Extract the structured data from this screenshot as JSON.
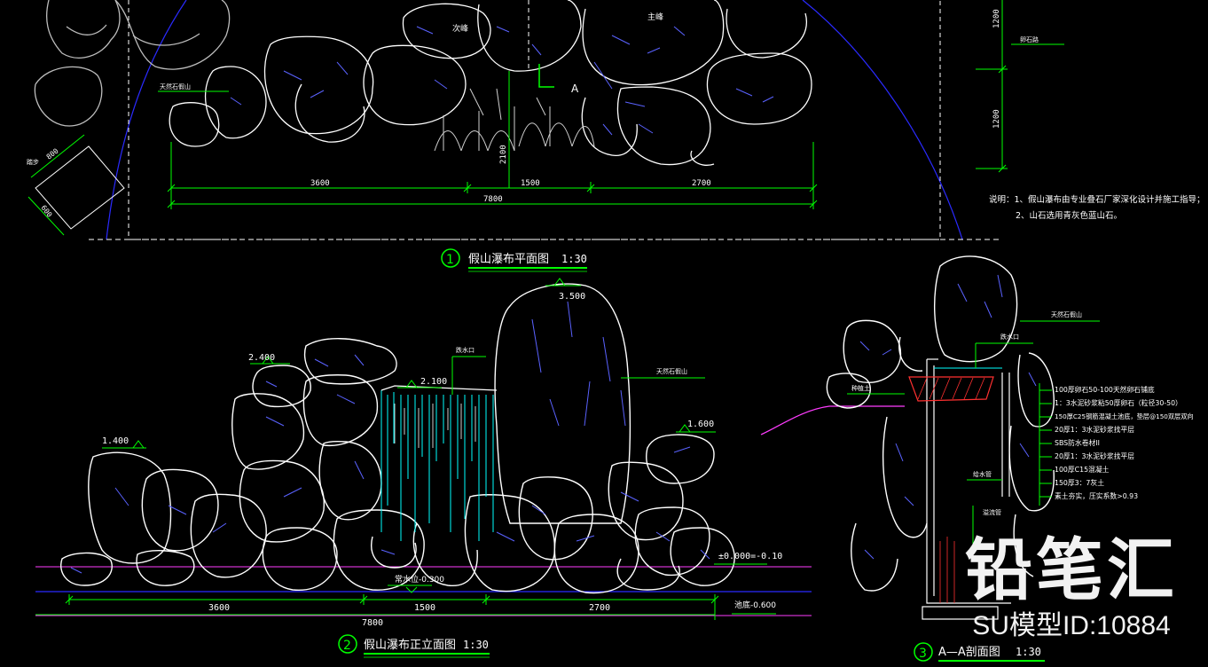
{
  "colors": {
    "rock": "#ffffff",
    "crack": "#5a62ff",
    "dim": "#00ff00",
    "label": "#ffffff",
    "water": "#00ffff",
    "ground": "#ff3cff",
    "hatch": "#ff3030",
    "boundary": "#2a2aff"
  },
  "plan": {
    "title": "假山瀑布平面图",
    "number": "1",
    "scale": "1:30",
    "labels": {
      "secondary_peak": "次峰",
      "main_peak": "主峰",
      "rock": "天然石假山",
      "path": "卵石路",
      "section_mark": "A",
      "steps": "踏步"
    },
    "dims": {
      "d1": "3600",
      "d2": "1500",
      "d3": "2700",
      "total": "7800",
      "depth": "2100",
      "right_top": "1200",
      "right_bottom": "1200",
      "step_w": "800",
      "step_d": "600"
    },
    "notes": [
      "说明：1、假山瀑布由专业叠石厂家深化设计并施工指导；",
      "2、山石选用青灰色蓝山石。"
    ]
  },
  "elevation": {
    "title": "假山瀑布正立面图",
    "number": "2",
    "scale": "1:30",
    "levels": {
      "top": "3.500",
      "left_mid": "2.400",
      "outlet": "2.100",
      "left": "1.400",
      "right": "1.600",
      "ground": "±0.000=-0.10",
      "water": "常水位-0.300",
      "bottom": "池底-0.600"
    },
    "labels": {
      "rock": "天然石假山",
      "outlet": "跌水口"
    },
    "dims": {
      "d1": "3600",
      "d2": "1500",
      "d3": "2700",
      "total": "7800"
    }
  },
  "section": {
    "title": "A—A剖面图",
    "number": "3",
    "scale": "1:30",
    "labels": {
      "rock": "天然石假山",
      "outlet": "跌水口",
      "soil": "种植土",
      "pipe": "给水管",
      "drain": "溢流管"
    },
    "layers": [
      "100厚卵石50-100天然卵石铺底",
      "1：3水泥砂浆粘50厚卵石（粒径30-50）",
      "150厚C25钢筋混凝土池底，垫层@150双层双向",
      "20厚1：3水泥砂浆找平层",
      "SBS防水卷材II",
      "20厚1：3水泥砂浆找平层",
      "100厚C15混凝土",
      "150厚3：7灰土",
      "素土夯实，压实系数>0.93"
    ]
  },
  "watermark": {
    "logo": "铅笔汇",
    "id": "SU模型ID:10884"
  }
}
